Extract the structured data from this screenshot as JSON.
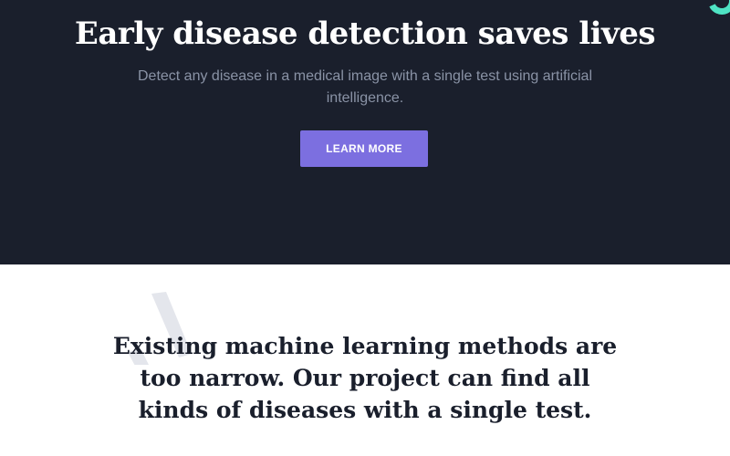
{
  "hero": {
    "title": "Early disease detection saves lives",
    "subtitle": "Detect any disease in a medical image with a single test using artificial intelligence.",
    "cta_label": "LEARN MORE"
  },
  "section": {
    "statement": "Existing machine learning methods are too narrow. Our project can find all kinds of diseases with a single test."
  },
  "colors": {
    "hero_background": "#1a1f2c",
    "accent": "#7c6fe0",
    "corner_accent": "#4fe3c4",
    "subtitle_text": "#8a93a6",
    "heading_dark": "#1a1f2c"
  },
  "icons": {
    "decor": "quote-mark-decoration-icon"
  }
}
